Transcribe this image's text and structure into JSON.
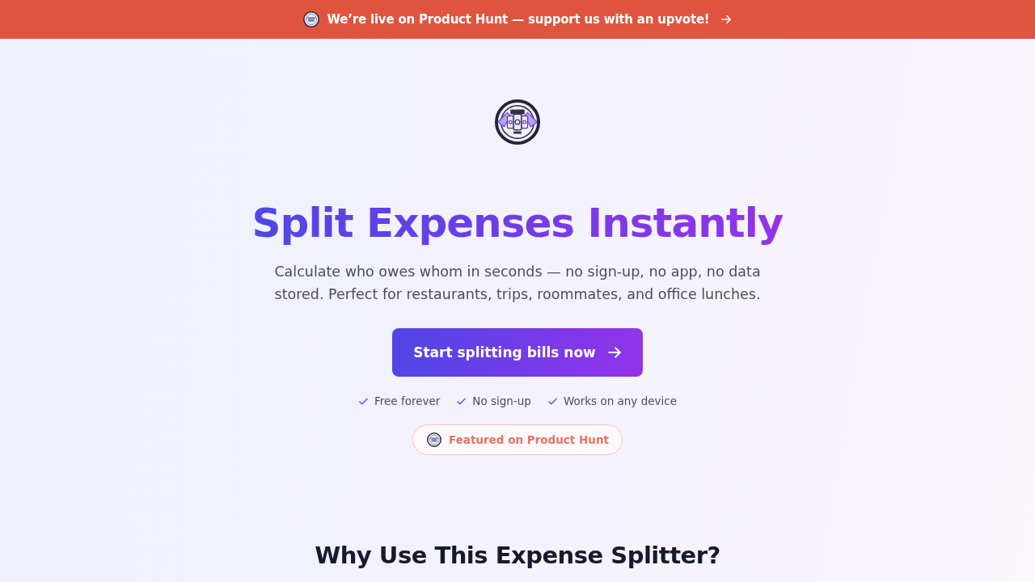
{
  "banner": {
    "text": "We’re live on Product Hunt — support us with an upvote!"
  },
  "hero": {
    "title": "Split Expenses Instantly",
    "subtitle": "Calculate who owes whom in seconds — no sign-up, no app, no data stored. Perfect for restaurants, trips, roommates, and office lunches.",
    "cta": "Start splitting bills now",
    "features": [
      "Free forever",
      "No sign-up",
      "Works on any device"
    ],
    "badge": "Featured on Product Hunt"
  },
  "section": {
    "title": "Why Use This Expense Splitter?"
  }
}
